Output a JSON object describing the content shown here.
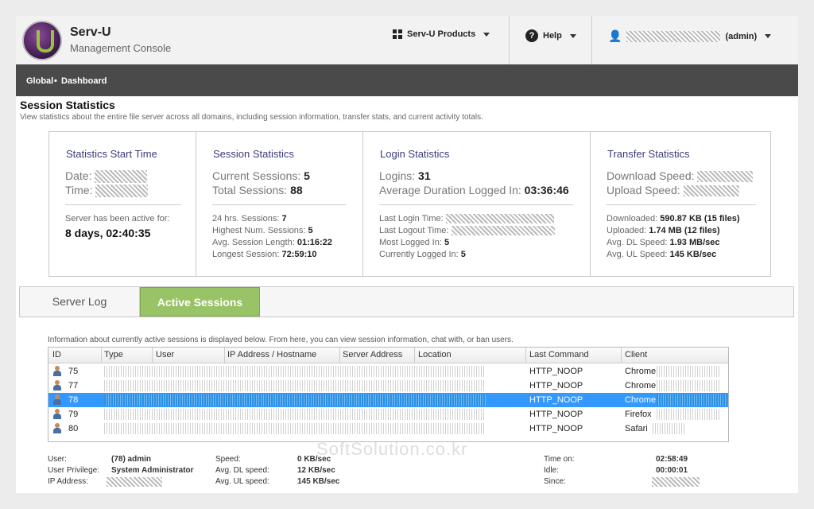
{
  "header": {
    "app_title": "Serv-U",
    "app_subtitle": "Management Console",
    "products_label": "Serv-U Products",
    "help_label": "Help",
    "user_label": "(admin)"
  },
  "breadcrumb": {
    "first": "Global",
    "sep": "•",
    "second": "Dashboard"
  },
  "page": {
    "title": "Session Statistics",
    "description": "View statistics about the entire file server across all domains, including session information, transfer stats, and current activity totals."
  },
  "stats": {
    "start": {
      "heading": "Statistics Start Time",
      "date_label": "Date:",
      "time_label": "Time:",
      "active_label": "Server has been active for:",
      "active_value": "8 days, 02:40:35"
    },
    "session": {
      "heading": "Session Statistics",
      "current_label": "Current Sessions:",
      "current_value": "5",
      "total_label": "Total Sessions:",
      "total_value": "88",
      "s24_label": "24 hrs. Sessions:",
      "s24_value": "7",
      "highest_label": "Highest Num. Sessions:",
      "highest_value": "5",
      "avg_label": "Avg. Session Length:",
      "avg_value": "01:16:22",
      "longest_label": "Longest Session:",
      "longest_value": "72:59:10"
    },
    "login": {
      "heading": "Login Statistics",
      "logins_label": "Logins:",
      "logins_value": "31",
      "avgdur_label": "Average Duration Logged In:",
      "avgdur_value": "03:36:46",
      "lastlogin_label": "Last Login Time:",
      "lastlogout_label": "Last Logout Time:",
      "most_label": "Most Logged In:",
      "most_value": "5",
      "currently_label": "Currently Logged In:",
      "currently_value": "5"
    },
    "transfer": {
      "heading": "Transfer Statistics",
      "dl_speed_label": "Download Speed:",
      "ul_speed_label": "Upload Speed:",
      "downloaded_label": "Downloaded:",
      "downloaded_value": "590.87 KB (15 files)",
      "uploaded_label": "Uploaded:",
      "uploaded_value": "1.74 MB (12 files)",
      "avgdl_label": "Avg. DL Speed:",
      "avgdl_value": "1.93 MB/sec",
      "avgul_label": "Avg. UL Speed:",
      "avgul_value": "145 KB/sec"
    }
  },
  "tabs": {
    "server_log": "Server Log",
    "active_sessions": "Active Sessions"
  },
  "sessions": {
    "info": "Information about currently active sessions is displayed below. From here, you can view session information, chat with, or ban users.",
    "columns": [
      "ID",
      "Type",
      "User",
      "IP Address / Hostname",
      "Server Address",
      "Location",
      "Last Command",
      "Client"
    ],
    "rows": [
      {
        "id": "75",
        "last_command": "HTTP_NOOP",
        "client": "Chrome"
      },
      {
        "id": "77",
        "last_command": "HTTP_NOOP",
        "client": "Chrome"
      },
      {
        "id": "78",
        "last_command": "HTTP_NOOP",
        "client": "Chrome"
      },
      {
        "id": "79",
        "last_command": "HTTP_NOOP",
        "client": "Firefox"
      },
      {
        "id": "80",
        "last_command": "HTTP_NOOP",
        "client": "Safari"
      }
    ]
  },
  "details": {
    "user_label": "User:",
    "user_value": "(78) admin",
    "priv_label": "User Privilege:",
    "priv_value": "System Administrator",
    "ip_label": "IP Address:",
    "speed_label": "Speed:",
    "speed_value": "0 KB/sec",
    "avgdl_label": "Avg. DL speed:",
    "avgdl_value": "12 KB/sec",
    "avgul_label": "Avg. UL speed:",
    "avgul_value": "145 KB/sec",
    "timeon_label": "Time on:",
    "timeon_value": "02:58:49",
    "idle_label": "Idle:",
    "idle_value": "00:00:01",
    "since_label": "Since:"
  },
  "watermark": "SoftSolution.co.kr"
}
